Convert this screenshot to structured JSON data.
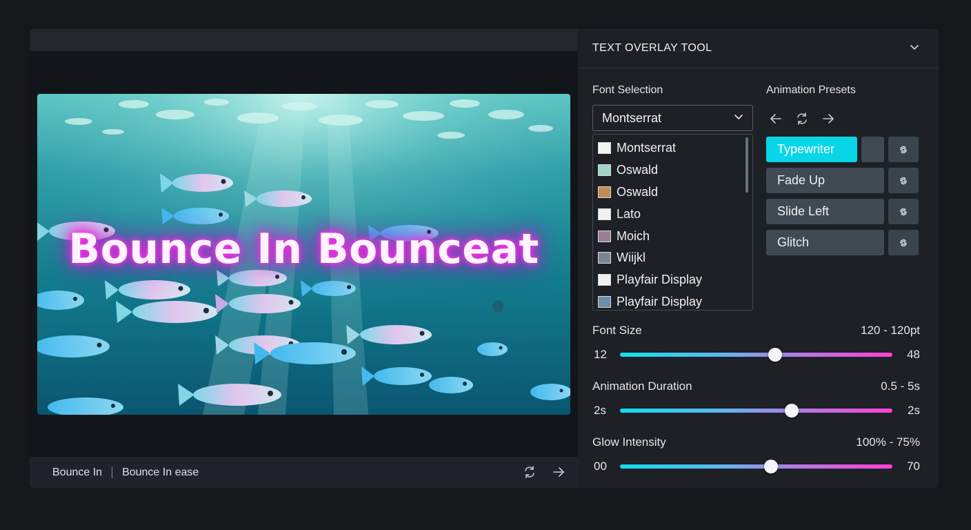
{
  "canvas": {
    "overlay_text": "Bounce In Bounceat"
  },
  "bottom_bar": {
    "animation_name": "Bounce In",
    "easing_name": "Bounce In ease",
    "icons": [
      "refresh-icon",
      "arrow-right-icon"
    ]
  },
  "panel": {
    "title": "TEXT OVERLAY TOOL",
    "font_selection": {
      "label": "Font Selection",
      "selected": "Montserrat",
      "items": [
        {
          "name": "Montserrat",
          "thumb": "#f4f4f4"
        },
        {
          "name": "Oswald",
          "thumb": "#9fd4c8"
        },
        {
          "name": "Oswald",
          "thumb": "#c28a55"
        },
        {
          "name": "Lato",
          "thumb": "#f2f2f2"
        },
        {
          "name": "Moich",
          "thumb": "#9a7f96"
        },
        {
          "name": "Wiijkl",
          "thumb": "#7a8896"
        },
        {
          "name": "Playfair Display",
          "thumb": "#f0f0f0"
        },
        {
          "name": "Playfair Display",
          "thumb": "#6d8fa6"
        }
      ]
    },
    "animation_presets": {
      "label": "Animation Presets",
      "nav_icons": [
        "arrow-left-icon",
        "refresh-icon",
        "arrow-right-icon"
      ],
      "items": [
        {
          "label": "Typewriter",
          "active": true
        },
        {
          "label": "Fade Up",
          "active": false
        },
        {
          "label": "Slide Left",
          "active": false
        },
        {
          "label": "Glitch",
          "active": false
        }
      ]
    },
    "font_size": {
      "label": "Font Size",
      "range_text": "120 - 120pt",
      "min": "12",
      "max": "48",
      "value_fraction": 0.57
    },
    "animation_duration": {
      "label": "Animation Duration",
      "range_text": "0.5 - 5s",
      "min": "2s",
      "max": "2s",
      "value_fraction": 0.63
    },
    "glow_intensity": {
      "label": "Glow Intensity",
      "range_text": "100% - 75%",
      "min": "00",
      "max": "70",
      "value_fraction": 0.555
    }
  },
  "colors": {
    "accent_cyan": "#08d6e6",
    "glow_magenta": "#f02fe0"
  }
}
